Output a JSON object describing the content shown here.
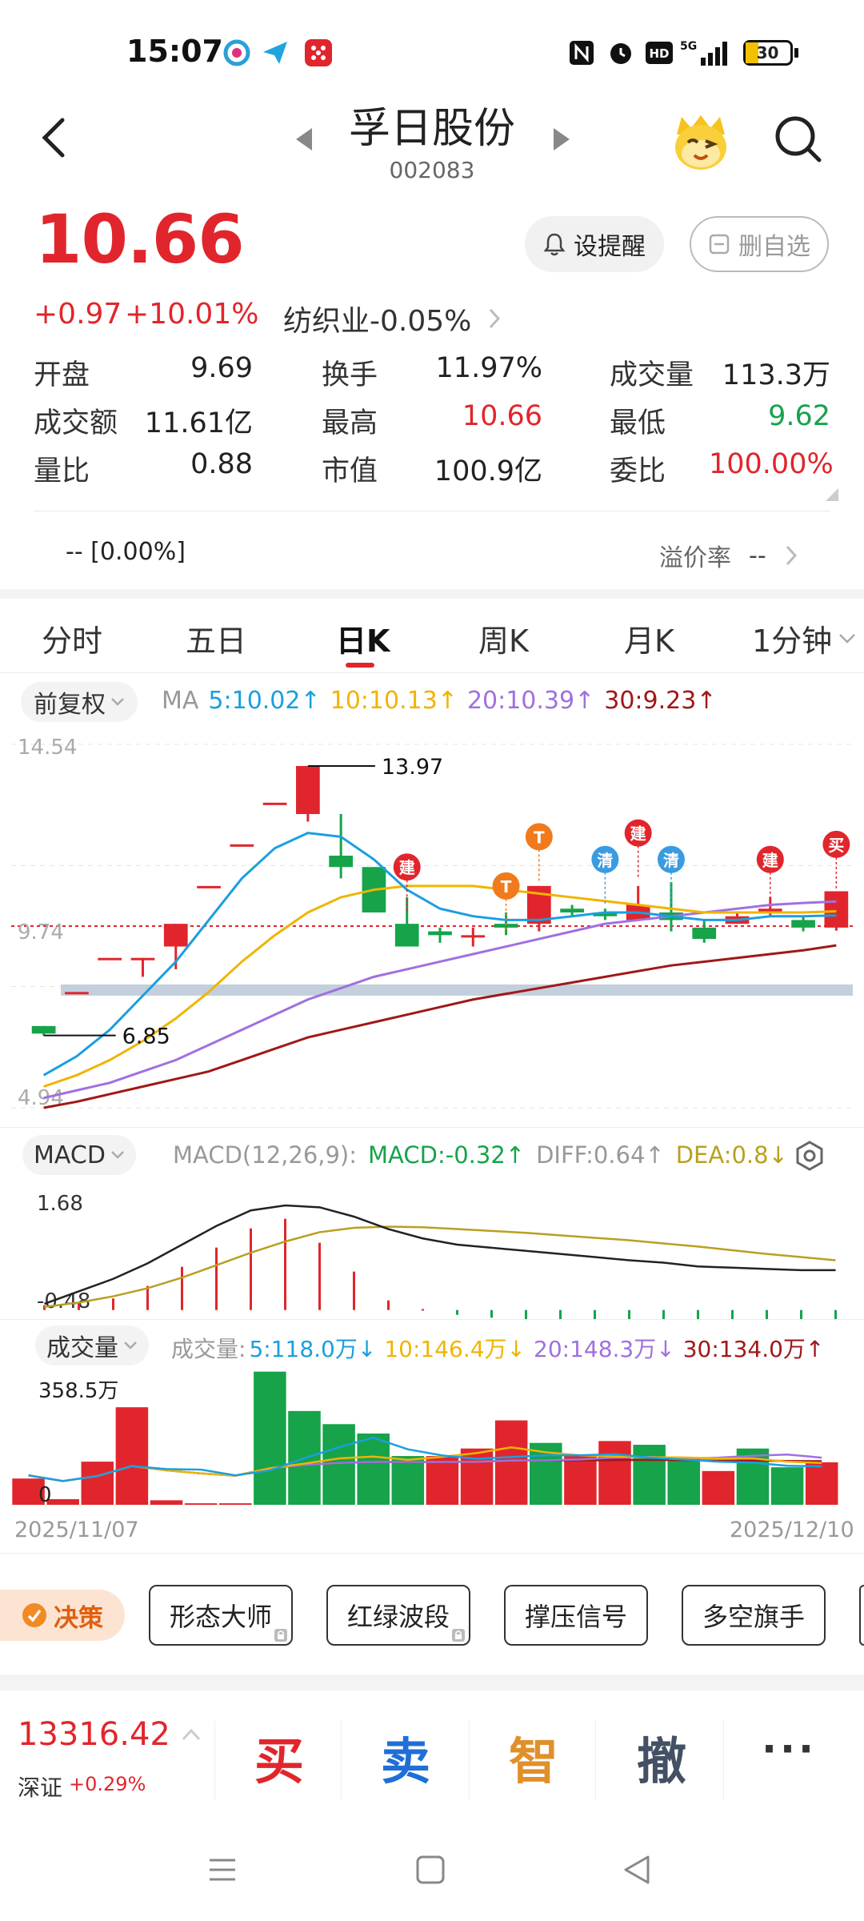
{
  "status": {
    "time": "15:07",
    "battery": "30",
    "net": "5G"
  },
  "header": {
    "title": "孚日股份",
    "code": "002083"
  },
  "quote": {
    "price": "10.66",
    "change": "+0.97",
    "change_pct": "+10.01%",
    "industry": "纺织业-0.05%",
    "alert_label": "设提醒",
    "watch_label": "删自选"
  },
  "stats": [
    {
      "label": "开盘",
      "value": "9.69"
    },
    {
      "label": "换手",
      "value": "11.97%"
    },
    {
      "label": "成交量",
      "value": "113.3万"
    },
    {
      "label": "成交额",
      "value": "11.61亿"
    },
    {
      "label": "最高",
      "value": "10.66"
    },
    {
      "label": "最低",
      "value": "9.62"
    },
    {
      "label": "量比",
      "value": "0.88"
    },
    {
      "label": "市值",
      "value": "100.9亿"
    },
    {
      "label": "委比",
      "value": "100.00%"
    }
  ],
  "premium": {
    "left": "--  [0.00%]",
    "label": "溢价率",
    "value": "--"
  },
  "tabs": [
    "分时",
    "五日",
    "日K",
    "周K",
    "月K",
    "1分钟"
  ],
  "ma_legend": {
    "adjust": "前复权",
    "title": "MA",
    "ma5": "5:10.02↑",
    "ma10": "10:10.13↑",
    "ma20": "20:10.39↑",
    "ma30": "30:9.23↑"
  },
  "macd_legend": {
    "name": "MACD",
    "params": "MACD(12,26,9):",
    "macd": "MACD:-0.32↑",
    "diff": "DIFF:0.64↑",
    "dea": "DEA:0.8↓"
  },
  "vol_legend": {
    "name": "成交量",
    "prefix": "成交量:",
    "v5": "5:118.0万↓",
    "v10": "10:146.4万↓",
    "v20": "20:148.3万↓",
    "v30": "30:134.0万↑"
  },
  "chart_data": [
    {
      "type": "candlestick",
      "ylim": [
        4.94,
        14.54
      ],
      "y_tick_labels": [
        "14.54",
        "9.74",
        "4.94"
      ],
      "annotations": [
        {
          "text": "13.97",
          "value": 13.97
        },
        {
          "text": "6.85",
          "value": 6.85
        }
      ],
      "markers": [
        "建",
        "T",
        "T",
        "建",
        "清",
        "清",
        "建",
        "买"
      ],
      "candles": [
        {
          "o": 7.1,
          "c": 6.9,
          "h": 7.1,
          "l": 6.85
        },
        {
          "o": 8.0,
          "c": 8.0,
          "h": 8.0,
          "l": 8.0
        },
        {
          "o": 8.9,
          "c": 8.9,
          "h": 8.9,
          "l": 8.9
        },
        {
          "o": 8.9,
          "c": 8.9,
          "h": 8.9,
          "l": 8.4
        },
        {
          "o": 9.2,
          "c": 9.8,
          "h": 9.8,
          "l": 8.6
        },
        {
          "o": 10.8,
          "c": 10.8,
          "h": 10.8,
          "l": 10.8
        },
        {
          "o": 11.9,
          "c": 11.9,
          "h": 11.9,
          "l": 11.9
        },
        {
          "o": 13.0,
          "c": 13.0,
          "h": 13.0,
          "l": 13.0
        },
        {
          "o": 12.7,
          "c": 13.97,
          "h": 13.97,
          "l": 12.5
        },
        {
          "o": 11.6,
          "c": 11.3,
          "h": 12.7,
          "l": 11.0
        },
        {
          "o": 11.3,
          "c": 10.1,
          "h": 11.3,
          "l": 10.1
        },
        {
          "o": 9.8,
          "c": 9.2,
          "h": 10.5,
          "l": 9.2
        },
        {
          "o": 9.6,
          "c": 9.5,
          "h": 9.7,
          "l": 9.3
        },
        {
          "o": 9.5,
          "c": 9.5,
          "h": 9.7,
          "l": 9.2
        },
        {
          "o": 9.8,
          "c": 9.7,
          "h": 10.1,
          "l": 9.5
        },
        {
          "o": 9.8,
          "c": 10.8,
          "h": 10.8,
          "l": 9.6
        },
        {
          "o": 10.2,
          "c": 10.1,
          "h": 10.3,
          "l": 10.0
        },
        {
          "o": 10.1,
          "c": 10.0,
          "h": 10.2,
          "l": 9.9
        },
        {
          "o": 9.9,
          "c": 10.3,
          "h": 10.8,
          "l": 9.9
        },
        {
          "o": 10.1,
          "c": 9.9,
          "h": 10.9,
          "l": 9.6
        },
        {
          "o": 9.7,
          "c": 9.4,
          "h": 9.9,
          "l": 9.3
        },
        {
          "o": 9.8,
          "c": 10.0,
          "h": 10.1,
          "l": 9.8
        },
        {
          "o": 10.1,
          "c": 10.2,
          "h": 10.5,
          "l": 10.0
        },
        {
          "o": 9.9,
          "c": 9.7,
          "h": 10.0,
          "l": 9.6
        },
        {
          "o": 9.7,
          "c": 10.66,
          "h": 10.66,
          "l": 9.62
        }
      ],
      "ma": {
        "ma5": [
          5.8,
          6.3,
          7.0,
          7.9,
          8.8,
          9.9,
          11.0,
          11.8,
          12.2,
          12.1,
          11.5,
          10.7,
          10.2,
          10.0,
          9.9,
          9.9,
          10.0,
          10.1,
          10.1,
          10.0,
          9.9,
          9.9,
          10.0,
          10.0,
          10.02
        ],
        "ma10": [
          5.5,
          5.8,
          6.2,
          6.7,
          7.3,
          8.0,
          8.8,
          9.5,
          10.1,
          10.5,
          10.7,
          10.8,
          10.8,
          10.8,
          10.7,
          10.6,
          10.5,
          10.4,
          10.3,
          10.2,
          10.1,
          10.1,
          10.1,
          10.1,
          10.13
        ],
        "ma20": [
          5.2,
          5.4,
          5.6,
          5.9,
          6.2,
          6.6,
          7.0,
          7.4,
          7.8,
          8.1,
          8.4,
          8.6,
          8.8,
          9.0,
          9.2,
          9.4,
          9.6,
          9.8,
          9.9,
          10.0,
          10.1,
          10.2,
          10.3,
          10.35,
          10.39
        ],
        "ma30": [
          4.94,
          5.1,
          5.3,
          5.5,
          5.7,
          5.9,
          6.2,
          6.5,
          6.8,
          7.0,
          7.2,
          7.4,
          7.6,
          7.8,
          7.95,
          8.1,
          8.25,
          8.4,
          8.55,
          8.7,
          8.8,
          8.9,
          9.0,
          9.1,
          9.23
        ]
      },
      "ma_colors": {
        "ma5": "#1a9fe0",
        "ma10": "#f0b400",
        "ma20": "#a070e0",
        "ma30": "#a01818"
      }
    },
    {
      "type": "bar",
      "title": "MACD",
      "ylim": [
        -0.48,
        1.68
      ],
      "y_tick_labels": [
        "1.68",
        "-0.48"
      ],
      "histogram": [
        0.05,
        0.08,
        0.12,
        0.25,
        0.45,
        0.65,
        0.85,
        0.95,
        0.7,
        0.4,
        0.1,
        0.01,
        -0.05,
        -0.08,
        -0.1,
        -0.12,
        -0.14,
        -0.16,
        -0.18,
        -0.2,
        -0.22,
        -0.26,
        -0.3,
        -0.32
      ],
      "diff": [
        0.1,
        0.3,
        0.5,
        0.75,
        1.05,
        1.35,
        1.6,
        1.68,
        1.65,
        1.5,
        1.3,
        1.15,
        1.05,
        1.0,
        0.95,
        0.9,
        0.85,
        0.8,
        0.76,
        0.7,
        0.68,
        0.66,
        0.64,
        0.64
      ],
      "dea": [
        0.05,
        0.12,
        0.22,
        0.35,
        0.52,
        0.72,
        0.92,
        1.1,
        1.25,
        1.32,
        1.34,
        1.33,
        1.3,
        1.27,
        1.24,
        1.2,
        1.16,
        1.12,
        1.07,
        1.02,
        0.96,
        0.9,
        0.85,
        0.8
      ],
      "colors": {
        "diff": "#222222",
        "dea": "#b8a020",
        "up": "#e0262c",
        "down": "#16a34a"
      }
    },
    {
      "type": "bar",
      "title": "成交量",
      "ylim": [
        0,
        358.5
      ],
      "y_tick_labels": [
        "358.5万",
        "0"
      ],
      "x_tick_labels": [
        "2025/11/07",
        "2025/12/10"
      ],
      "volumes": [
        70,
        15,
        115,
        260,
        12,
        4,
        4,
        355,
        250,
        215,
        190,
        130,
        130,
        150,
        225,
        165,
        130,
        170,
        160,
        125,
        90,
        150,
        100,
        113.3
      ],
      "up": [
        true,
        true,
        true,
        true,
        true,
        true,
        true,
        false,
        false,
        false,
        false,
        false,
        true,
        true,
        true,
        false,
        true,
        true,
        false,
        false,
        true,
        false,
        false,
        true
      ],
      "colors": {
        "up": "#e0262c",
        "down": "#16a34a"
      }
    }
  ],
  "strategy": {
    "badge": "决策",
    "buttons": [
      "形态大师",
      "红绿波段",
      "撑压信号",
      "多空旗手"
    ]
  },
  "bottom": {
    "index_value": "13316.42",
    "index_name": "深证",
    "index_change": "+0.29%",
    "buy": "买",
    "sell": "卖",
    "smart": "智",
    "cancel": "撤",
    "more": "···"
  }
}
